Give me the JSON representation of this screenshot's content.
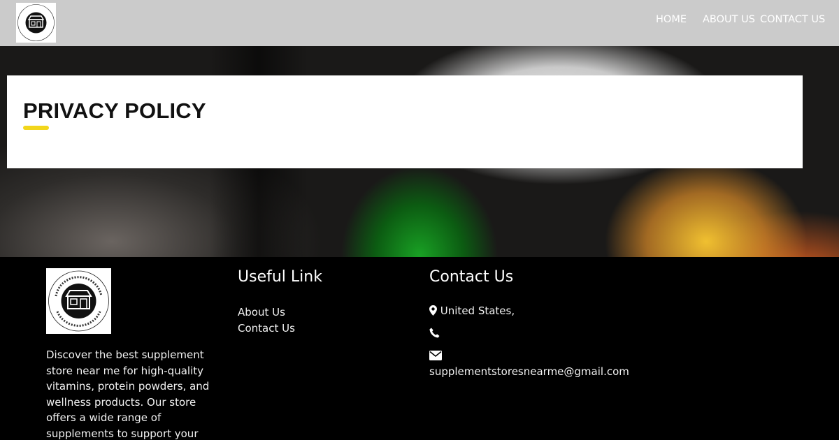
{
  "header": {
    "logo_alt": "Supplement Store Near Me - Best Local Supplement",
    "nav": {
      "home": "HOME",
      "about": "ABOUT US",
      "contact": "CONTACT US"
    }
  },
  "hero": {
    "title": "PRIVACY POLICY",
    "accent_color": "#f2d61c"
  },
  "footer": {
    "description": "Discover the best supplement store near me for high-quality vitamins, protein powders, and wellness products. Our store offers a wide range of supplements to support your",
    "useful_title": "Useful Link",
    "links": [
      "About Us",
      "Contact Us"
    ],
    "contact_title": "Contact Us",
    "location": "United States,",
    "phone": "",
    "email": "supplementstoresnearme@gmail.com",
    "icons": {
      "location": "map-marker-icon",
      "phone": "phone-icon",
      "email": "envelope-icon"
    }
  }
}
